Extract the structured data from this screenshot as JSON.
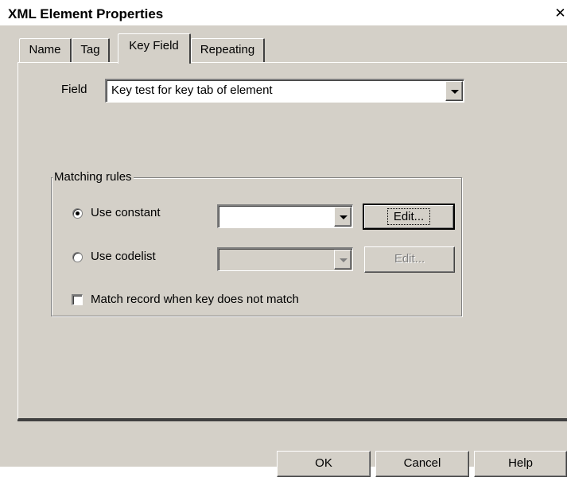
{
  "window": {
    "title": "XML Element Properties",
    "close_glyph": "✕"
  },
  "tabs": [
    {
      "label": "Name",
      "active": false
    },
    {
      "label": "Tag",
      "active": false
    },
    {
      "label": "Key Field",
      "active": true
    },
    {
      "label": "Repeating",
      "active": false
    }
  ],
  "field": {
    "label": "Field",
    "value": "Key test for key tab of element"
  },
  "matching_rules": {
    "legend": "Matching rules",
    "use_constant": {
      "label": "Use constant",
      "selected": true,
      "value": "",
      "edit_label": "Edit..."
    },
    "use_codelist": {
      "label": "Use codelist",
      "selected": false,
      "value": "",
      "edit_label": "Edit..."
    },
    "match_record": {
      "label": "Match record when key does not match",
      "checked": false
    }
  },
  "footer": {
    "ok_label": "OK",
    "cancel_label": "Cancel",
    "help_label": "Help"
  },
  "colors": {
    "face": "#d4d0c8",
    "highlight": "#ffffff",
    "shadow": "#808080",
    "dark_shadow": "#404040"
  }
}
